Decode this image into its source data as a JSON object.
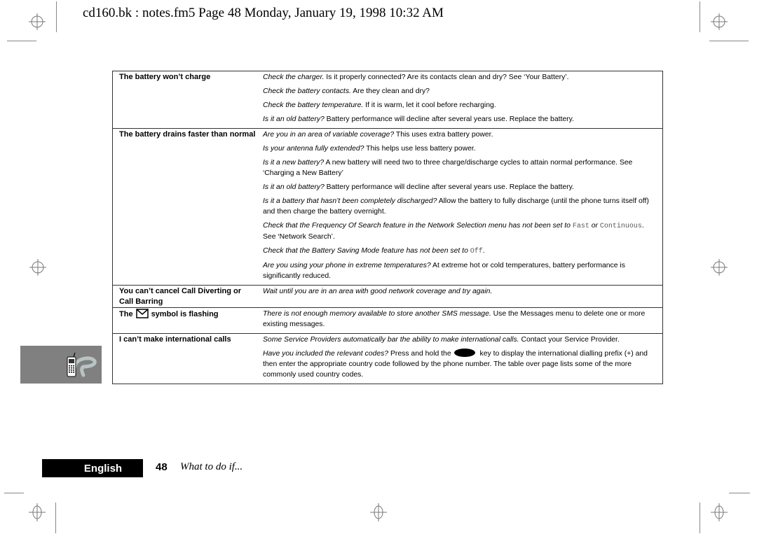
{
  "header": {
    "print_info": "cd160.bk : notes.fm5  Page 48  Monday, January 19, 1998  10:32 AM"
  },
  "table": {
    "rows": [
      {
        "problem": "The battery won’t charge",
        "answers": [
          {
            "lead": "Check the charger.",
            "text": " Is it properly connected? Are its contacts clean and dry? See ‘Your Battery’."
          },
          {
            "lead": "Check the battery contacts.",
            "text": " Are they clean and dry?"
          },
          {
            "lead": "Check the battery temperature.",
            "text": " If it is warm, let it cool before recharging."
          },
          {
            "lead": "Is it an old battery?",
            "text": " Battery performance will decline after several years use. Replace the battery."
          }
        ]
      },
      {
        "problem": "The battery drains faster than normal",
        "answers": [
          {
            "lead": "Are you in an area of variable coverage?",
            "text": " This uses extra battery power."
          },
          {
            "lead": "Is your antenna fully extended?",
            "text": " This helps use less battery power."
          },
          {
            "lead": "Is it a new battery?",
            "text": " A new battery will need two to three charge/discharge cycles to attain normal performance. See ‘Charging a New Battery’"
          },
          {
            "lead": "Is it an old battery?",
            "text": " Battery performance will decline after several years use. Replace the battery."
          },
          {
            "lead": "Is it a battery that hasn’t been completely discharged?",
            "text": " Allow the battery to fully discharge (until the phone turns itself off) and then charge the battery overnight."
          },
          {
            "lead": "Check that the Frequency Of Search feature in the Network Selection menu has not been set to",
            "mono1": "Fast",
            "mid": " or ",
            "mono2": "Continuous",
            "text": ". See ‘Network Search’."
          },
          {
            "lead": "Check that the Battery Saving Mode feature has not been set to",
            "mono1": "Off",
            "text": "."
          },
          {
            "lead": "Are you using your phone in extreme temperatures?",
            "text": " At extreme hot or cold temperatures, battery performance is significantly reduced."
          }
        ]
      },
      {
        "problem": "You can’t cancel Call Diverting or Call Barring",
        "answers": [
          {
            "lead": "Wait until you are in an area with good network coverage and try again.",
            "text": ""
          }
        ]
      },
      {
        "problem_before": "The",
        "problem_icon": "envelope-icon",
        "problem_after": "symbol is flashing",
        "answers": [
          {
            "lead": "There is not enough memory available to store another SMS message.",
            "text": " Use the Messages menu to delete one or more existing messages."
          }
        ]
      },
      {
        "problem": "I can’t make international calls",
        "answers": [
          {
            "lead": "Some Service Providers automatically bar the ability to make international calls.",
            "text": " Contact your Service Provider."
          },
          {
            "lead": "Have you included the relevant codes?",
            "text_before": " Press and hold the",
            "key_icon": "phone-key-icon",
            "text": " key to display the international dialling prefix (+) and then enter the appropriate country code followed by the phone number. The table over page lists some of the more commonly used country codes."
          }
        ]
      }
    ]
  },
  "side_tab": {
    "icon": "phone-question-icon"
  },
  "footer": {
    "language": "English",
    "page_number": "48",
    "section": "What to do if..."
  }
}
